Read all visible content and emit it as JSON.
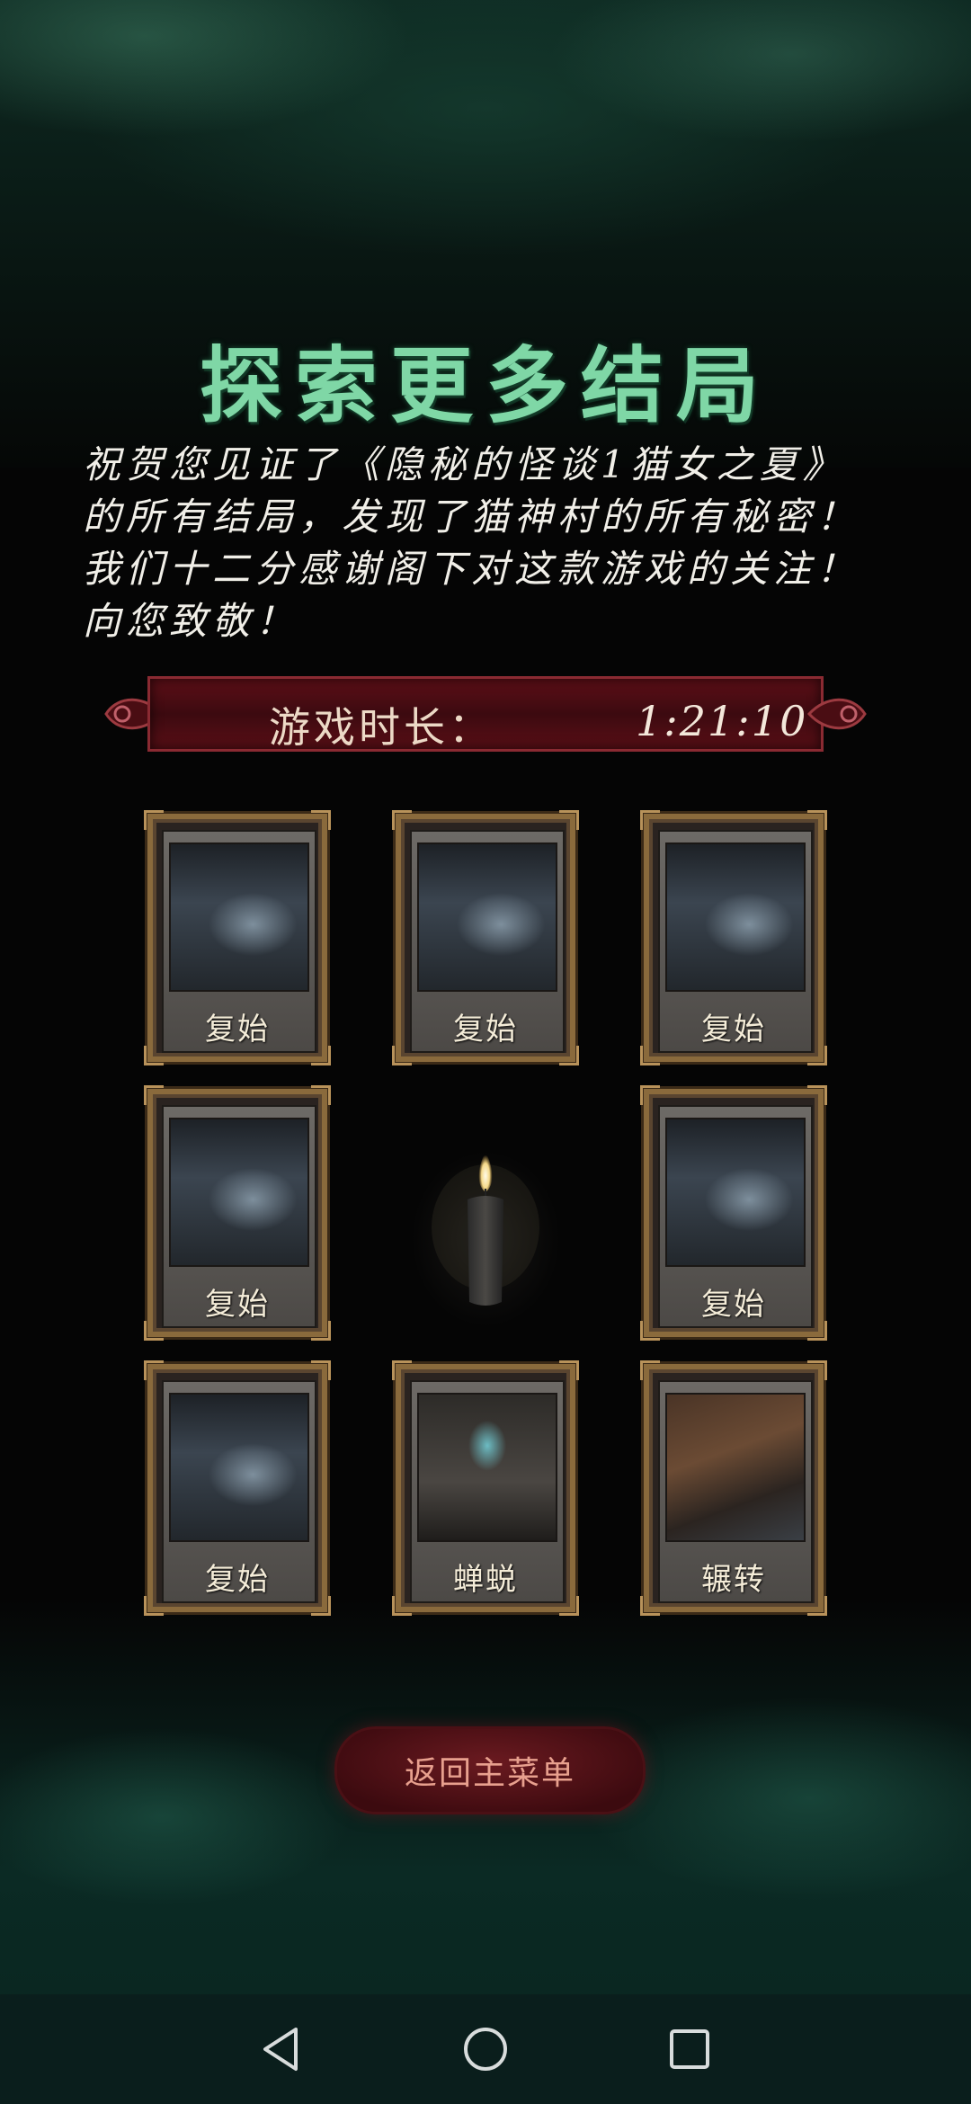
{
  "title": "探索更多结局",
  "message": "祝贺您见证了《隐秘的怪谈1猫女之夏》的所有结局，发现了猫神村的所有秘密！我们十二分感谢阁下对这款游戏的关注！向您致敬！",
  "playtime": {
    "label": "游戏时长：",
    "value": "1:21:10"
  },
  "endings": [
    {
      "label": "复始",
      "icon": "misty-forest"
    },
    {
      "label": "复始",
      "icon": "misty-forest"
    },
    {
      "label": "复始",
      "icon": "misty-forest"
    },
    {
      "label": "复始",
      "icon": "misty-forest"
    },
    {
      "label": "复始",
      "icon": "misty-forest"
    },
    {
      "label": "复始",
      "icon": "misty-forest"
    },
    {
      "label": "蝉蜕",
      "icon": "armor-figure"
    },
    {
      "label": "辗转",
      "icon": "open-book-desk"
    }
  ],
  "center_icon": "candle",
  "menu_button": "返回主菜单",
  "navigation": {
    "back_icon": "back-triangle-icon",
    "home_icon": "home-circle-icon",
    "recents_icon": "recents-square-icon"
  },
  "colors": {
    "title": "#7fd7a6",
    "banner": "#5d0f17",
    "card_border": "#8a6a3c",
    "menu_text": "#e8a08e"
  }
}
